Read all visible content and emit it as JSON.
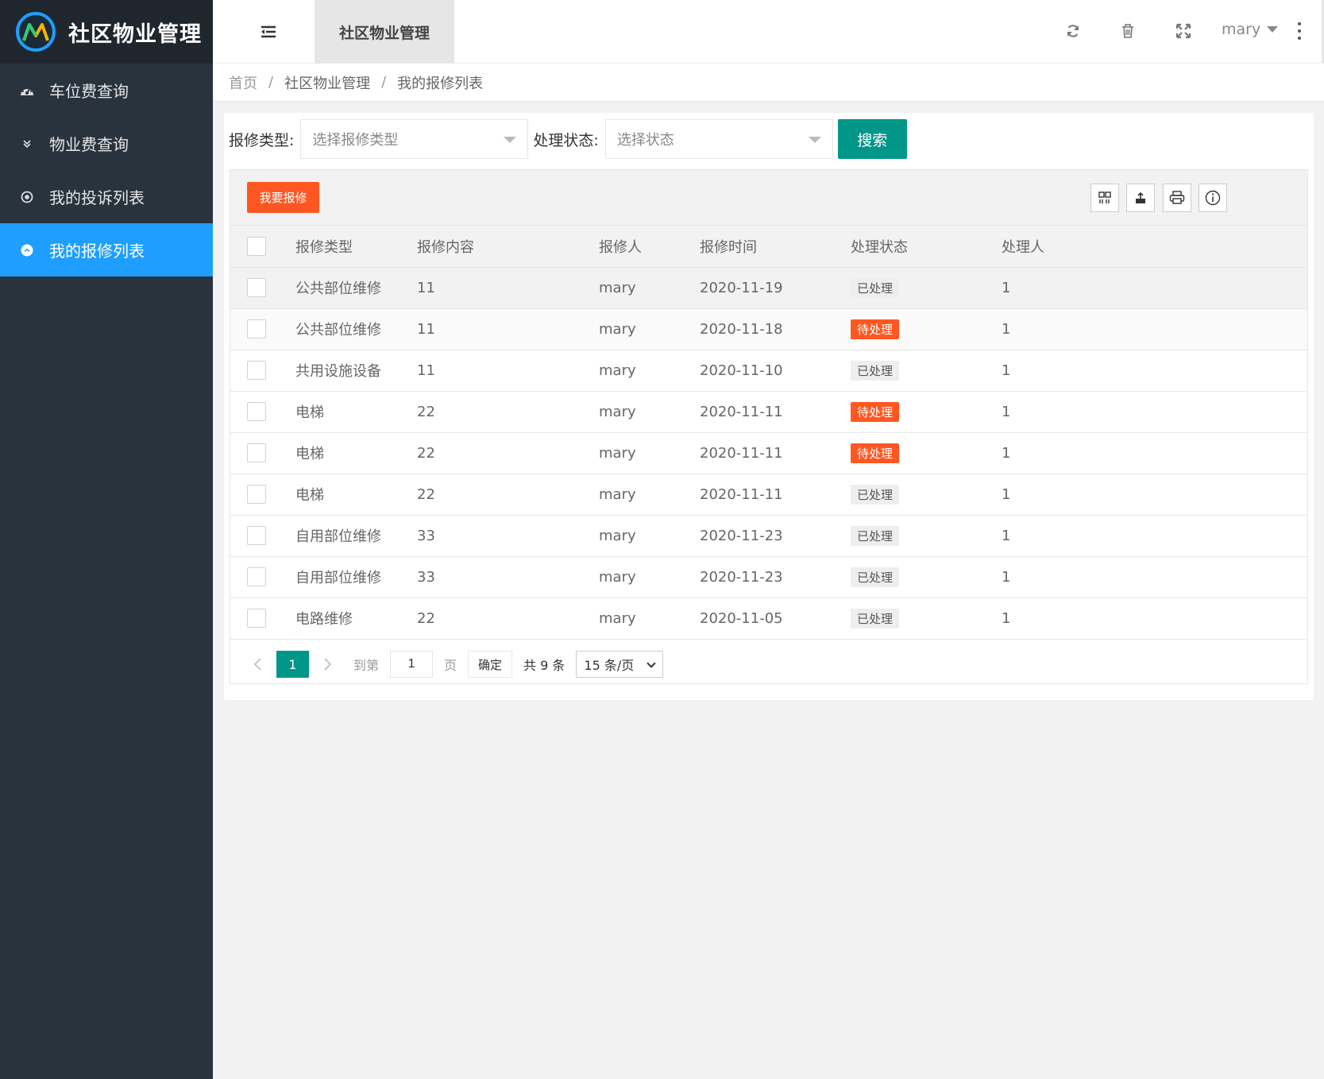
{
  "app": {
    "title": "社区物业管理",
    "accent": "#009688",
    "sidebar_active_color": "#1e9fff",
    "danger": "#ff5722"
  },
  "sidebar": {
    "items": [
      {
        "label": "车位费查询",
        "icon": "dashboard-icon"
      },
      {
        "label": "物业费查询",
        "icon": "chevrons-down-icon"
      },
      {
        "label": "我的投诉列表",
        "icon": "circle-dot-icon"
      },
      {
        "label": "我的报修列表",
        "icon": "chevron-up-circle-icon",
        "active": true
      }
    ]
  },
  "header": {
    "tab_label": "社区物业管理",
    "user": "mary",
    "icons": [
      "menu-toggle-icon",
      "refresh-icon",
      "trash-icon",
      "fullscreen-icon",
      "more-vertical-icon"
    ]
  },
  "breadcrumb": [
    "首页",
    "社区物业管理",
    "我的报修列表"
  ],
  "search": {
    "type_label": "报修类型:",
    "type_placeholder": "选择报修类型",
    "status_label": "处理状态:",
    "status_placeholder": "选择状态",
    "search_button": "搜索"
  },
  "toolbar": {
    "add_button": "我要报修",
    "icons": [
      "columns-icon",
      "export-icon",
      "print-icon",
      "info-icon"
    ]
  },
  "table": {
    "columns": [
      "报修类型",
      "报修内容",
      "报修人",
      "报修时间",
      "处理状态",
      "处理人"
    ],
    "rows": [
      {
        "type": "公共部位维修",
        "content": "11",
        "person": "mary",
        "time": "2020-11-19",
        "status": "已处理",
        "status_kind": "done",
        "handler": "1"
      },
      {
        "type": "公共部位维修",
        "content": "11",
        "person": "mary",
        "time": "2020-11-18",
        "status": "待处理",
        "status_kind": "pending",
        "handler": "1"
      },
      {
        "type": "共用设施设备",
        "content": "11",
        "person": "mary",
        "time": "2020-11-10",
        "status": "已处理",
        "status_kind": "done",
        "handler": "1"
      },
      {
        "type": "电梯",
        "content": "22",
        "person": "mary",
        "time": "2020-11-11",
        "status": "待处理",
        "status_kind": "pending",
        "handler": "1"
      },
      {
        "type": "电梯",
        "content": "22",
        "person": "mary",
        "time": "2020-11-11",
        "status": "待处理",
        "status_kind": "pending",
        "handler": "1"
      },
      {
        "type": "电梯",
        "content": "22",
        "person": "mary",
        "time": "2020-11-11",
        "status": "已处理",
        "status_kind": "done",
        "handler": "1"
      },
      {
        "type": "自用部位维修",
        "content": "33",
        "person": "mary",
        "time": "2020-11-23",
        "status": "已处理",
        "status_kind": "done",
        "handler": "1"
      },
      {
        "type": "自用部位维修",
        "content": "33",
        "person": "mary",
        "time": "2020-11-23",
        "status": "已处理",
        "status_kind": "done",
        "handler": "1"
      },
      {
        "type": "电路维修",
        "content": "22",
        "person": "mary",
        "time": "2020-11-05",
        "status": "已处理",
        "status_kind": "done",
        "handler": "1"
      }
    ]
  },
  "pager": {
    "current_page": "1",
    "goto_label": "到第",
    "goto_value": "1",
    "page_unit": "页",
    "confirm": "确定",
    "total": "共 9 条",
    "page_size": "15 条/页"
  }
}
